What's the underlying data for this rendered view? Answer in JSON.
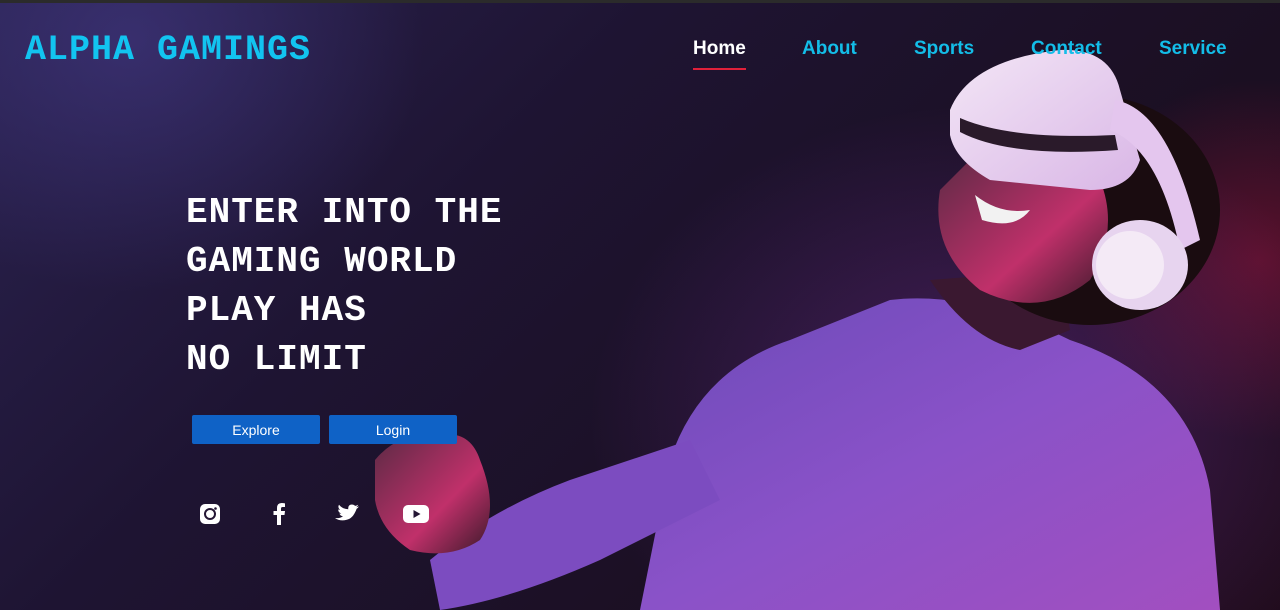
{
  "brand": {
    "name": "ALPHA GAMINGS"
  },
  "nav": {
    "items": [
      {
        "label": "Home",
        "active": true
      },
      {
        "label": "About"
      },
      {
        "label": "Sports"
      },
      {
        "label": "Contact"
      },
      {
        "label": "Service"
      }
    ]
  },
  "hero": {
    "headline_lines": [
      "ENTER INTO THE",
      "GAMING WORLD",
      "PLAY HAS",
      "NO LIMIT"
    ],
    "buttons": {
      "explore": "Explore",
      "login": "Login"
    },
    "image": "person-with-vr-headset"
  },
  "social": [
    "instagram-icon",
    "facebook-icon",
    "twitter-icon",
    "youtube-icon"
  ],
  "colors": {
    "brand": "#12c4f0",
    "nav_link": "#13bde8",
    "nav_active": "#ffffff",
    "nav_underline": "#e0203a",
    "button": "#0f62c6"
  }
}
